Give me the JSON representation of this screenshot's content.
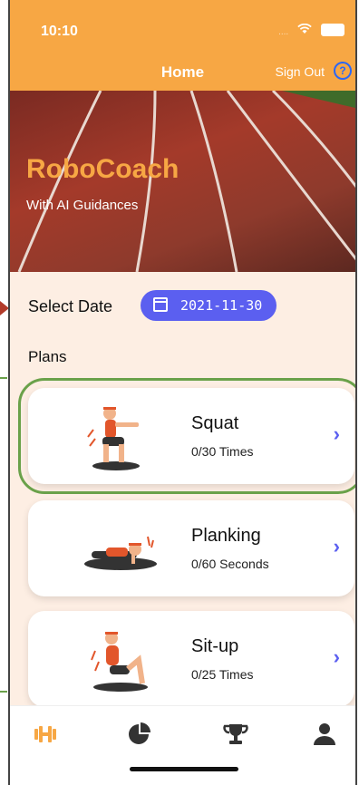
{
  "status": {
    "time": "10:10",
    "signal": "....",
    "wifi_icon": "wifi-icon",
    "battery_icon": "battery-icon"
  },
  "nav": {
    "title": "Home",
    "sign_out": "Sign Out",
    "help": "?"
  },
  "banner": {
    "title": "RoboCoach",
    "subtitle": "With AI Guidances"
  },
  "date": {
    "label": "Select Date",
    "value": "2021-11-30"
  },
  "plans": {
    "label": "Plans",
    "items": [
      {
        "name": "Squat",
        "progress": "0/30 Times",
        "icon": "squat-figure-icon",
        "selected": true
      },
      {
        "name": "Planking",
        "progress": "0/60 Seconds",
        "icon": "plank-figure-icon",
        "selected": false
      },
      {
        "name": "Sit-up",
        "progress": "0/25 Times",
        "icon": "situp-figure-icon",
        "selected": false
      }
    ]
  },
  "tabs": [
    {
      "name": "workout",
      "icon": "dumbbell-icon",
      "active": true
    },
    {
      "name": "stats",
      "icon": "pie-chart-icon",
      "active": false
    },
    {
      "name": "awards",
      "icon": "trophy-icon",
      "active": false
    },
    {
      "name": "profile",
      "icon": "user-icon",
      "active": false
    }
  ],
  "colors": {
    "accent": "#f7a744",
    "primary": "#5b5ff0",
    "background": "#fdeee3",
    "highlight": "#6aa14a"
  }
}
